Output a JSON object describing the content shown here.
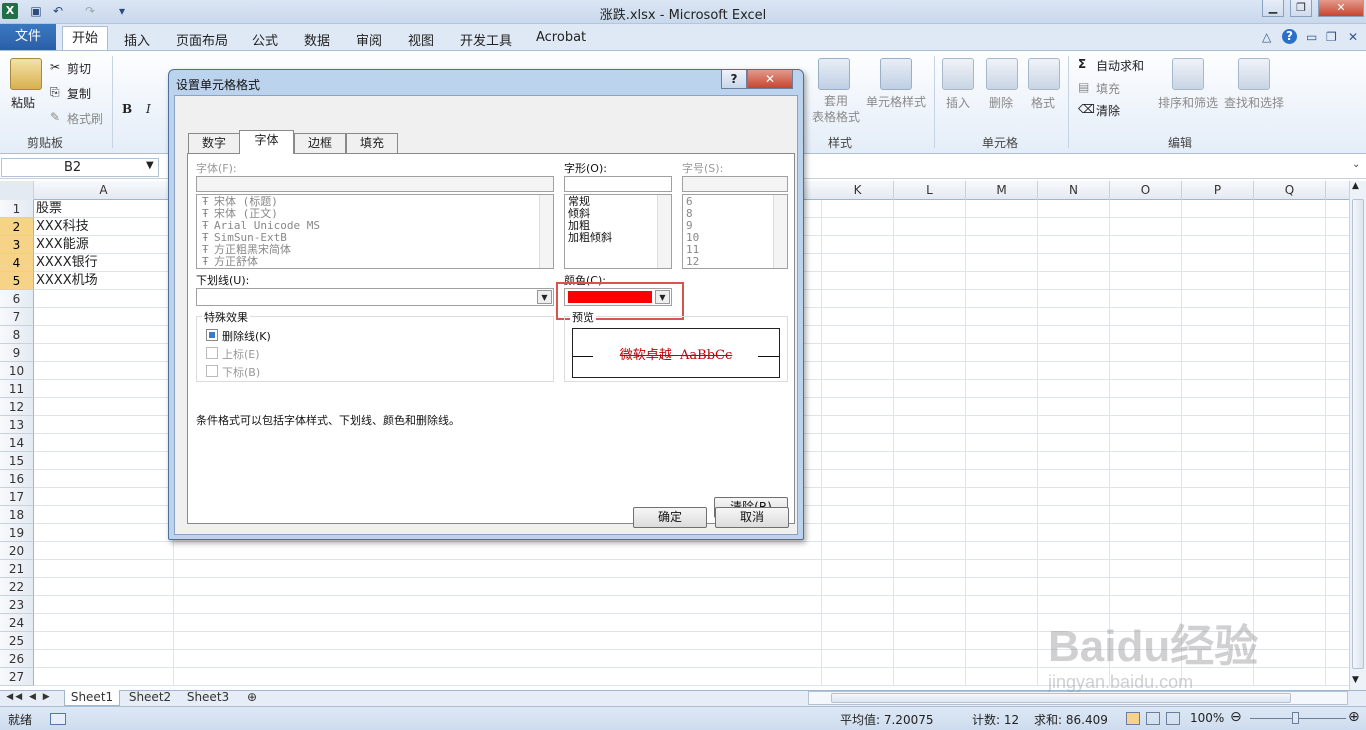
{
  "window": {
    "title": "涨跌.xlsx - Microsoft Excel"
  },
  "menu": {
    "file": "文件",
    "tabs": [
      "开始",
      "插入",
      "页面布局",
      "公式",
      "数据",
      "审阅",
      "视图",
      "开发工具",
      "Acrobat"
    ]
  },
  "ribbon": {
    "clipboard": {
      "paste": "粘贴",
      "cut": "剪切",
      "copy": "复制",
      "format_painter": "格式刷",
      "group": "剪贴板"
    },
    "styles": {
      "table_format": "套用\n表格格式",
      "cell_styles": "单元格样式",
      "group": "样式"
    },
    "cells": {
      "insert": "插入",
      "delete": "删除",
      "format": "格式",
      "group": "单元格"
    },
    "editing": {
      "autosum": "自动求和",
      "fill": "填充",
      "clear": "清除",
      "sort": "排序和筛选",
      "find": "查找和选择",
      "group": "编辑"
    }
  },
  "formula": {
    "name_box": "B2"
  },
  "columns_left": [
    "A"
  ],
  "columns_right": [
    "K",
    "L",
    "M",
    "N",
    "O",
    "P",
    "Q"
  ],
  "rows": [
    "1",
    "2",
    "3",
    "4",
    "5",
    "6",
    "7",
    "8",
    "9",
    "10",
    "11",
    "12",
    "13",
    "14",
    "15",
    "16",
    "17",
    "18",
    "19",
    "20",
    "21",
    "22",
    "23",
    "24",
    "25",
    "26",
    "27"
  ],
  "cells": [
    "股票",
    "XXX科技",
    "XXX能源",
    "XXXX银行",
    "XXXX机场"
  ],
  "sheets": [
    "Sheet1",
    "Sheet2",
    "Sheet3"
  ],
  "status": {
    "ready": "就绪",
    "average": "平均值: 7.20075",
    "count": "计数: 12",
    "sum": "求和: 86.409",
    "zoom": "100%"
  },
  "dialog": {
    "title": "设置单元格格式",
    "help": "?",
    "tabs": [
      "数字",
      "字体",
      "边框",
      "填充"
    ],
    "font_label": "字体(F):",
    "fonts": [
      "宋体 (标题)",
      "宋体 (正文)",
      "Arial Unicode MS",
      "SimSun-ExtB",
      "方正粗黑宋简体",
      "方正舒体"
    ],
    "style_label": "字形(O):",
    "styles": [
      "常规",
      "倾斜",
      "加粗",
      "加粗倾斜"
    ],
    "size_label": "字号(S):",
    "sizes": [
      "6",
      "8",
      "9",
      "10",
      "11",
      "12"
    ],
    "underline_label": "下划线(U):",
    "color_label": "颜色(C):",
    "color_value": "#ff0000",
    "effects_label": "特殊效果",
    "strikethrough": "删除线(K)",
    "superscript": "上标(E)",
    "subscript": "下标(B)",
    "preview_label": "预览",
    "preview_text": "微软卓越  AaBbCc",
    "note": "条件格式可以包括字体样式、下划线、颜色和删除线。",
    "clear": "清除(R)",
    "ok": "确定",
    "cancel": "取消"
  },
  "watermark": {
    "brand": "Baidu经验",
    "url": "jingyan.baidu.com"
  }
}
